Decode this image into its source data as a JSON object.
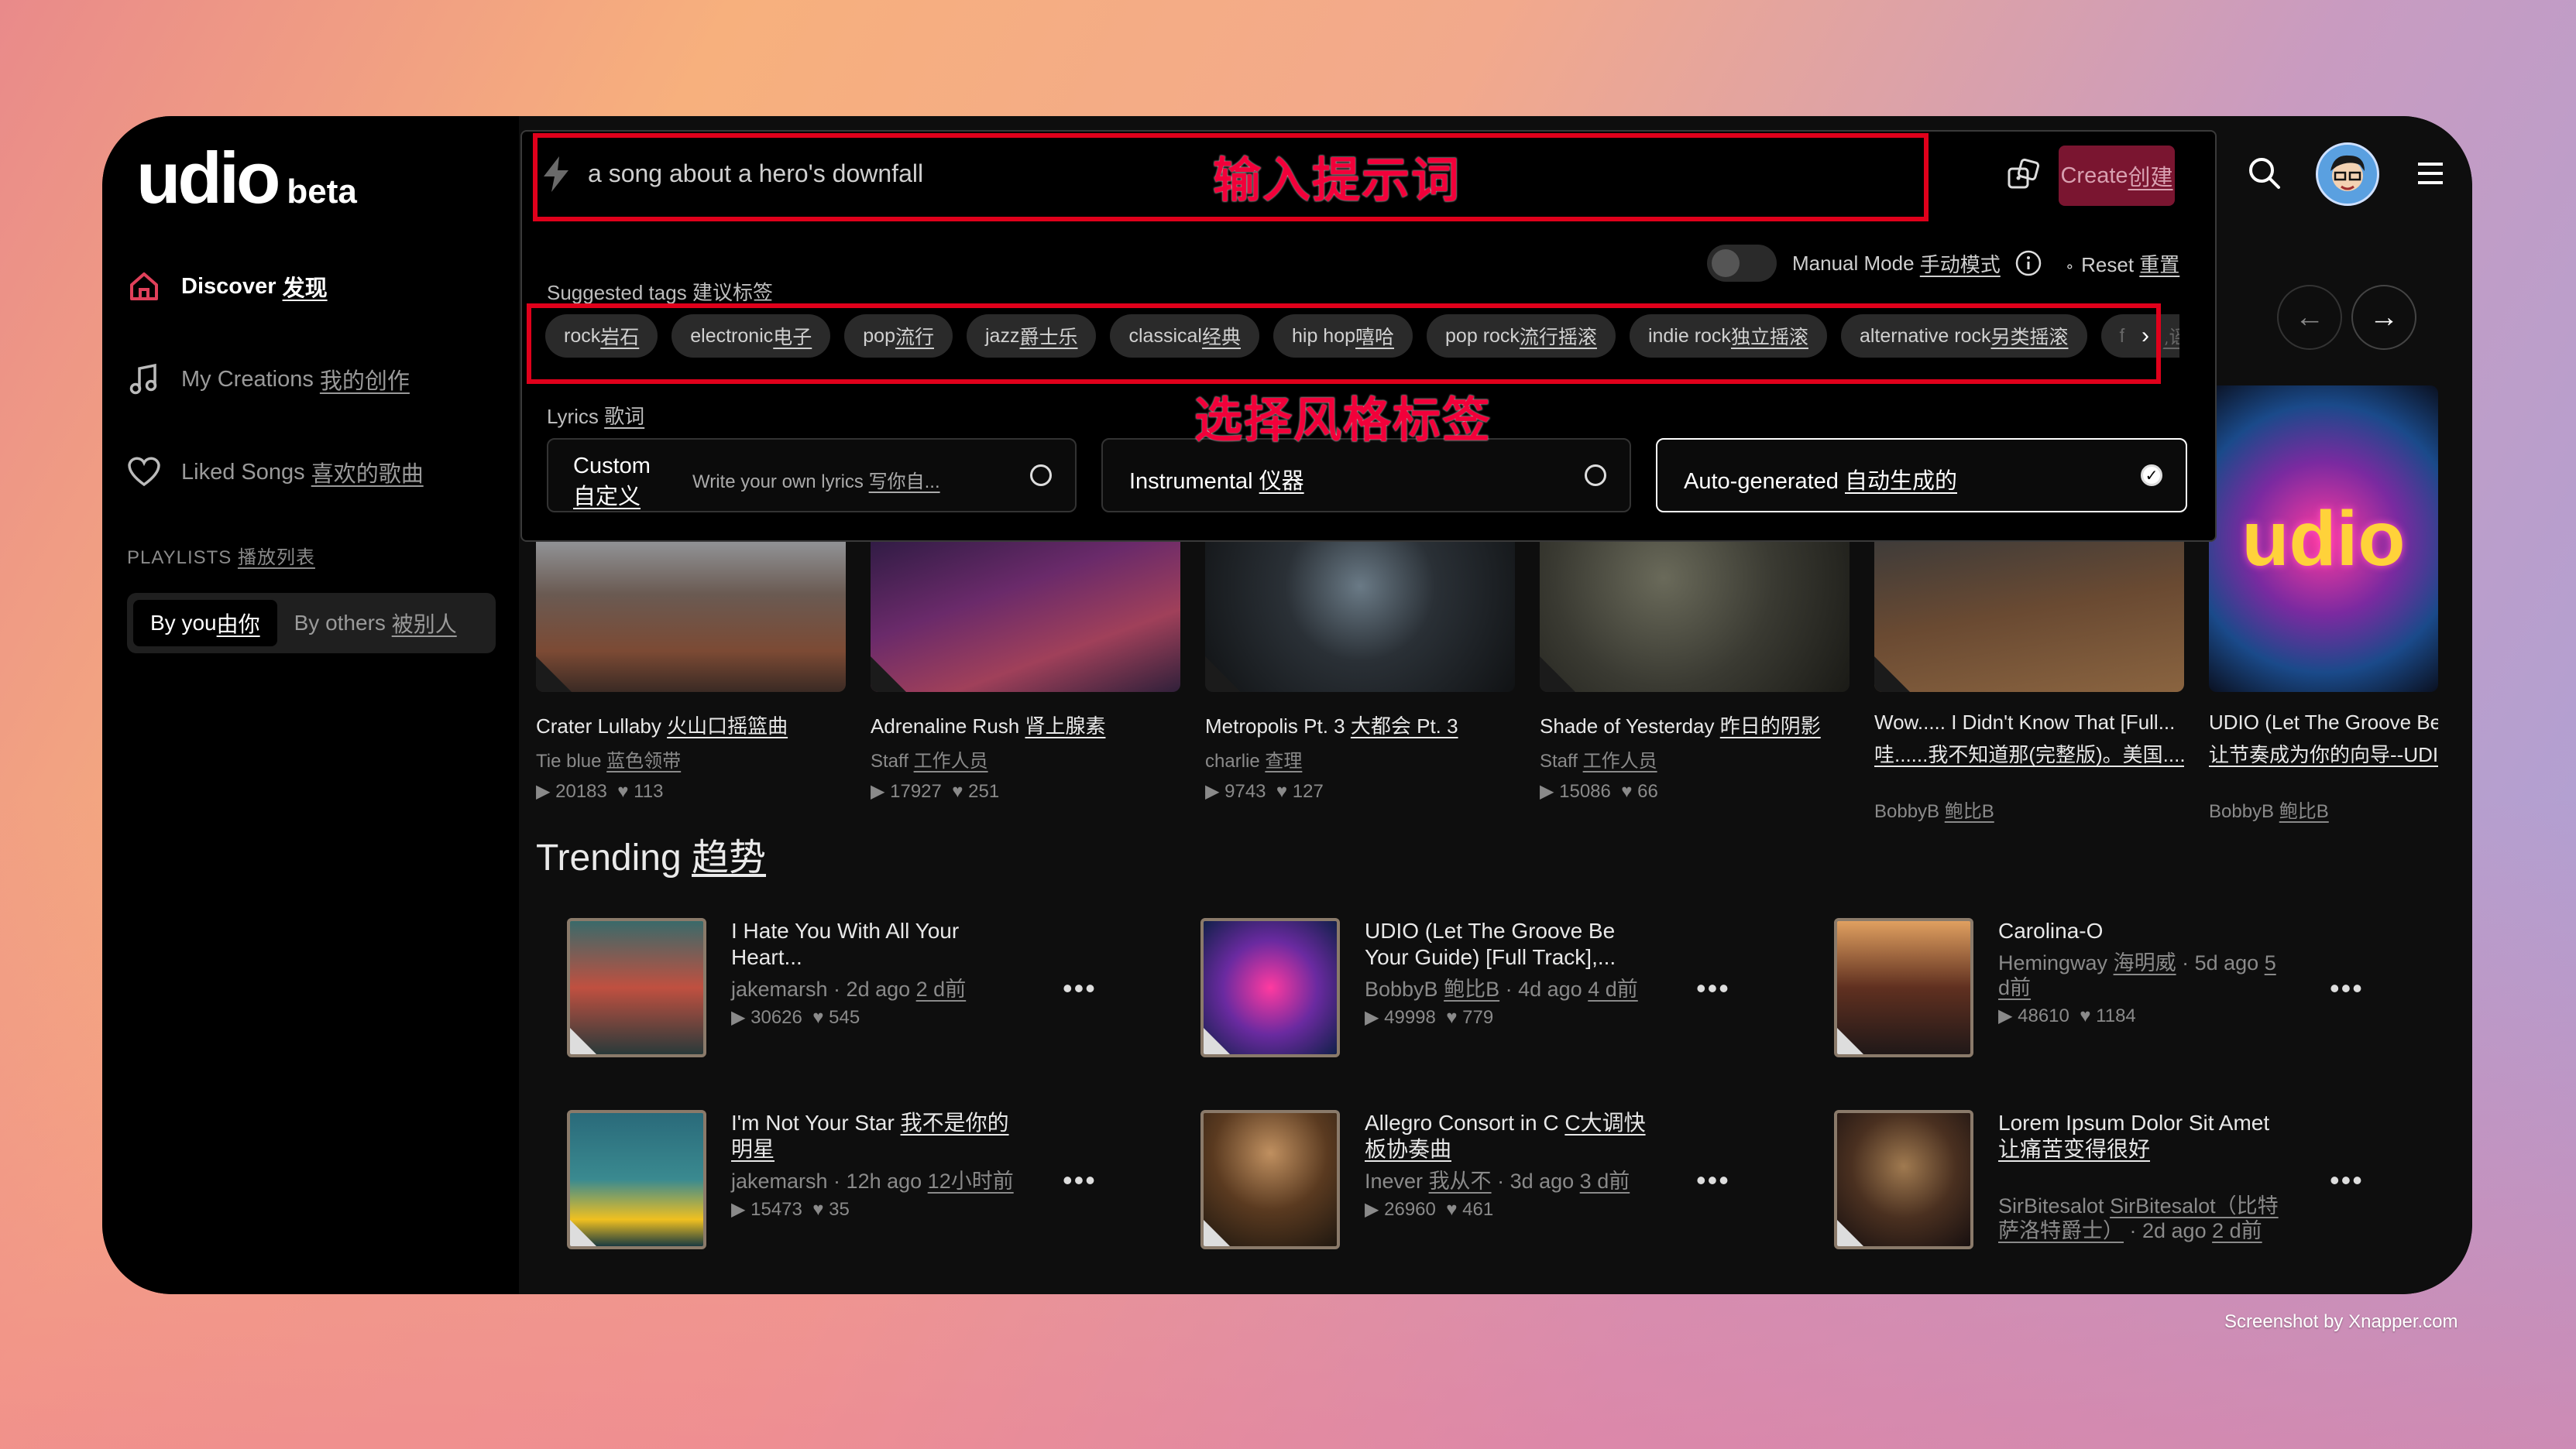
{
  "app": {
    "logo_wordmark": "udio",
    "logo_badge": "beta"
  },
  "sidebar": {
    "items": [
      {
        "label_en": "Discover",
        "label_zh": "发现"
      },
      {
        "label_en": "My Creations",
        "label_zh": "我的创作"
      },
      {
        "label_en": "Liked Songs",
        "label_zh": "喜欢的歌曲"
      }
    ],
    "playlists_label_en": "PLAYLISTS",
    "playlists_label_zh": "播放列表",
    "by_you_en": "By you",
    "by_you_zh": "由你",
    "by_others_en": "By others",
    "by_others_zh": "被别人"
  },
  "prompt": {
    "value": "a song about a hero's downfall",
    "create_en": "Create",
    "create_zh": "创建",
    "manual_mode_en": "Manual Mode",
    "manual_mode_zh": "手动模式",
    "reset_en": "Reset",
    "reset_zh": "重置",
    "suggested_en": "Suggested tags",
    "suggested_zh": "建议标签",
    "tags": [
      {
        "en": "rock",
        "zh": "岩石"
      },
      {
        "en": "electronic",
        "zh": "电子"
      },
      {
        "en": "pop",
        "zh": "流行"
      },
      {
        "en": "jazz",
        "zh": "爵士乐"
      },
      {
        "en": "classical",
        "zh": "经典"
      },
      {
        "en": "hip hop",
        "zh": "嘻哈"
      },
      {
        "en": "pop rock",
        "zh": "流行摇滚"
      },
      {
        "en": "indie rock",
        "zh": "独立摇滚"
      },
      {
        "en": "alternative rock",
        "zh": "另类摇滚"
      },
      {
        "en": "folk",
        "zh": "民谣"
      }
    ],
    "lyrics_en": "Lyrics",
    "lyrics_zh": "歌词",
    "opt_custom_en": "Custom",
    "opt_custom_zh": "自定义",
    "opt_custom_hint_en": "Write your own lyrics",
    "opt_custom_hint_zh": "写你自...",
    "opt_instr_en": "Instrumental",
    "opt_instr_zh": "仪器",
    "opt_auto_en": "Auto-generated",
    "opt_auto_zh": "自动生成的"
  },
  "annotations": {
    "prompt": "输入提示词",
    "tags": "选择风格标签"
  },
  "cards": [
    {
      "title_en": "Crater Lullaby",
      "title_zh": "火山口摇篮曲",
      "artist_en": "Tie blue",
      "artist_zh": "蓝色领带",
      "plays": "20183",
      "likes": "113"
    },
    {
      "title_en": "Adrenaline Rush",
      "title_zh": "肾上腺素",
      "artist_en": "Staff",
      "artist_zh": "工作人员",
      "plays": "17927",
      "likes": "251"
    },
    {
      "title_en": "Metropolis Pt. 3",
      "title_zh": "大都会 Pt. 3",
      "artist_en": "charlie",
      "artist_zh": "查理",
      "plays": "9743",
      "likes": "127"
    },
    {
      "title_en": "Shade of Yesterday",
      "title_zh": "昨日的阴影",
      "artist_en": "Staff",
      "artist_zh": "工作人员",
      "plays": "15086",
      "likes": "66"
    },
    {
      "title_en": "Wow..... I Didn't Know That [Full...",
      "title_zh": "哇......我不知道那(完整版)。美国.....",
      "artist_en": "BobbyB",
      "artist_zh": "鲍比B"
    },
    {
      "title_en": "UDIO (Let The Groove Be",
      "title_zh": "让节奏成为你的向导--UDI",
      "artist_en": "BobbyB",
      "artist_zh": "鲍比B"
    }
  ],
  "trending": {
    "title_en": "Trending",
    "title_zh": "趋势",
    "items": [
      {
        "title": "I Hate You With All Your Heart...",
        "artist_en": "jakemarsh",
        "artist_zh": "",
        "ago_en": "2d ago",
        "ago_zh": "2 d前",
        "plays": "30626",
        "likes": "545"
      },
      {
        "title": "UDIO (Let The Groove Be Your Guide) [Full Track],...",
        "artist_en": "BobbyB",
        "artist_zh": "鲍比B",
        "ago_en": "4d ago",
        "ago_zh": "4 d前",
        "plays": "49998",
        "likes": "779"
      },
      {
        "title": "Carolina-O",
        "artist_en": "Hemingway",
        "artist_zh": "海明威",
        "ago_en": "5d ago",
        "ago_zh": "5 d前",
        "plays": "48610",
        "likes": "1184"
      },
      {
        "title_en": "I'm Not Your Star",
        "title_zh": "我不是你的明星",
        "artist_en": "jakemarsh",
        "ago_en": "12h ago",
        "ago_zh": "12小时前",
        "plays": "15473",
        "likes": "35"
      },
      {
        "title_en": "Allegro Consort in C",
        "title_zh": "C大调快板协奏曲",
        "artist_en": "Inever",
        "artist_zh": "我从不",
        "ago_en": "3d ago",
        "ago_zh": "3 d前",
        "plays": "26960",
        "likes": "461"
      },
      {
        "title_en": "Lorem Ipsum Dolor Sit Amet",
        "title_zh": "让痛苦变得很好",
        "artist_en": "SirBitesalot",
        "artist_zh": "SirBitesalot（比特萨洛特爵士）",
        "ago_en": "2d ago",
        "ago_zh": "2 d前"
      }
    ]
  },
  "credit": "Screenshot by Xnapper.com",
  "colors": {
    "accent": "#7a1530",
    "annotation_red": "#e0001b"
  }
}
